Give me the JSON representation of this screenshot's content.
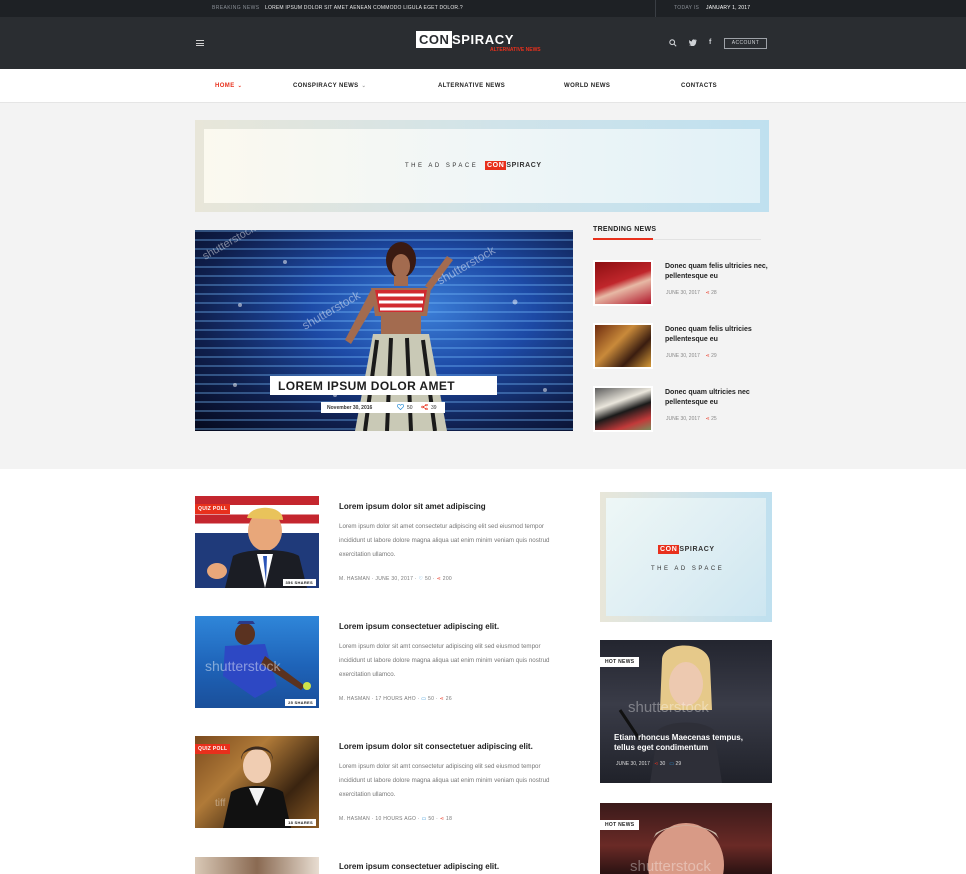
{
  "topbar": {
    "breaking_label": "BREAKING NEWS",
    "breaking_text": "LOREM IPSUM DOLOR SIT AMET AENEAN COMMODO LIGULA EGET DOLOR.?",
    "today_label": "TODAY IS",
    "today_date": "JANUARY 1, 2017"
  },
  "header": {
    "logo_con": "CON",
    "logo_spiracy": "SPIRACY",
    "logo_tagline": "ALTERNATIVE NEWS",
    "account_label": "ACCOUNT",
    "icons": [
      "menu-icon",
      "search-icon",
      "twitter-icon",
      "facebook-icon"
    ]
  },
  "nav": {
    "items": [
      {
        "label": "HOME"
      },
      {
        "label": "CONSPIRACY NEWS"
      },
      {
        "label": "ALTERNATIVE NEWS"
      },
      {
        "label": "WORLD NEWS"
      },
      {
        "label": "CONTACTS"
      }
    ]
  },
  "ad_top": {
    "prefix": "THE AD SPACE",
    "con": "CON",
    "spiracy": "SPIRACY"
  },
  "ad_side": {
    "con": "CON",
    "spiracy": "SPIRACY",
    "text": "THE AD SPACE"
  },
  "hero": {
    "title": "LOREM IPSUM DOLOR AMET",
    "date": "November 30, 2016",
    "likes": "50",
    "shares": "39",
    "watermark": "shutterstock"
  },
  "trending": {
    "title": "TRENDING NEWS",
    "items": [
      {
        "title": "Donec quam felis ultricies nec, pellentesque eu",
        "date": "JUNE 30, 2017",
        "shares": "28"
      },
      {
        "title": "Donec quam felis ultricies pellentesque eu",
        "date": "JUNE 30, 2017",
        "shares": "29"
      },
      {
        "title": "Donec quam ultricies nec pellentesque eu",
        "date": "JUNE 30, 2017",
        "shares": "25"
      }
    ]
  },
  "articles": [
    {
      "badge": "QUIZ POLL",
      "shares_badge": "356 SHARES",
      "title": "Lorem ipsum dolor sit amet adipiscing",
      "excerpt": "Lorem ipsum dolor sit amet consectetur adipiscing elit sed eiusmod tempor incididunt ut labore dolore magna aliqua uat enim minim veniam quis nostrud exercitation ullamco.",
      "author": "M. HASMAN",
      "date": "JUNE 30, 2017",
      "likes": "50",
      "shares": "200"
    },
    {
      "badge": "",
      "shares_badge": "25 SHARES",
      "title": "Lorem ipsum consectetuer adipiscing elit.",
      "excerpt": "Lorem ipsum dolor sit amt consectetur adipiscing elit sed eiusmod tempor incididunt ut labore dolore magna aliqua uat enim minim veniam quis nostrud exercitation ullamco.",
      "author": "M. HASMAN",
      "date": "17 HOURS AHO",
      "likes": "50",
      "shares": "26"
    },
    {
      "badge": "QUIZ POLL",
      "shares_badge": "18 SHARES",
      "title": "Lorem ipsum dolor sit consectetuer adipiscing elit.",
      "excerpt": "Lorem ipsum dolor sit amt consectetur adipiscing elit sed eiusmod tempor incididunt ut labore dolore magna aliqua uat enim minim veniam quis nostrud exercitation ullamco.",
      "author": "M. HASMAN",
      "date": "10 HOURS AGO",
      "likes": "50",
      "shares": "18"
    },
    {
      "badge": "",
      "shares_badge": "",
      "title": "Lorem ipsum consectetuer adipiscing elit.",
      "excerpt": "",
      "author": "",
      "date": "",
      "likes": "",
      "shares": ""
    }
  ],
  "hot_cards": [
    {
      "badge": "HOT NEWS",
      "title": "Etiam rhoncus Maecenas tempus, tellus eget condimentum",
      "date": "JUNE 30, 2017",
      "shares": "30",
      "comments": "29"
    },
    {
      "badge": "HOT NEWS"
    }
  ],
  "colors": {
    "accent": "#e8301c",
    "dark": "#2a2d31",
    "topbar": "#1e2125",
    "section_bg": "#f3f3f3"
  }
}
